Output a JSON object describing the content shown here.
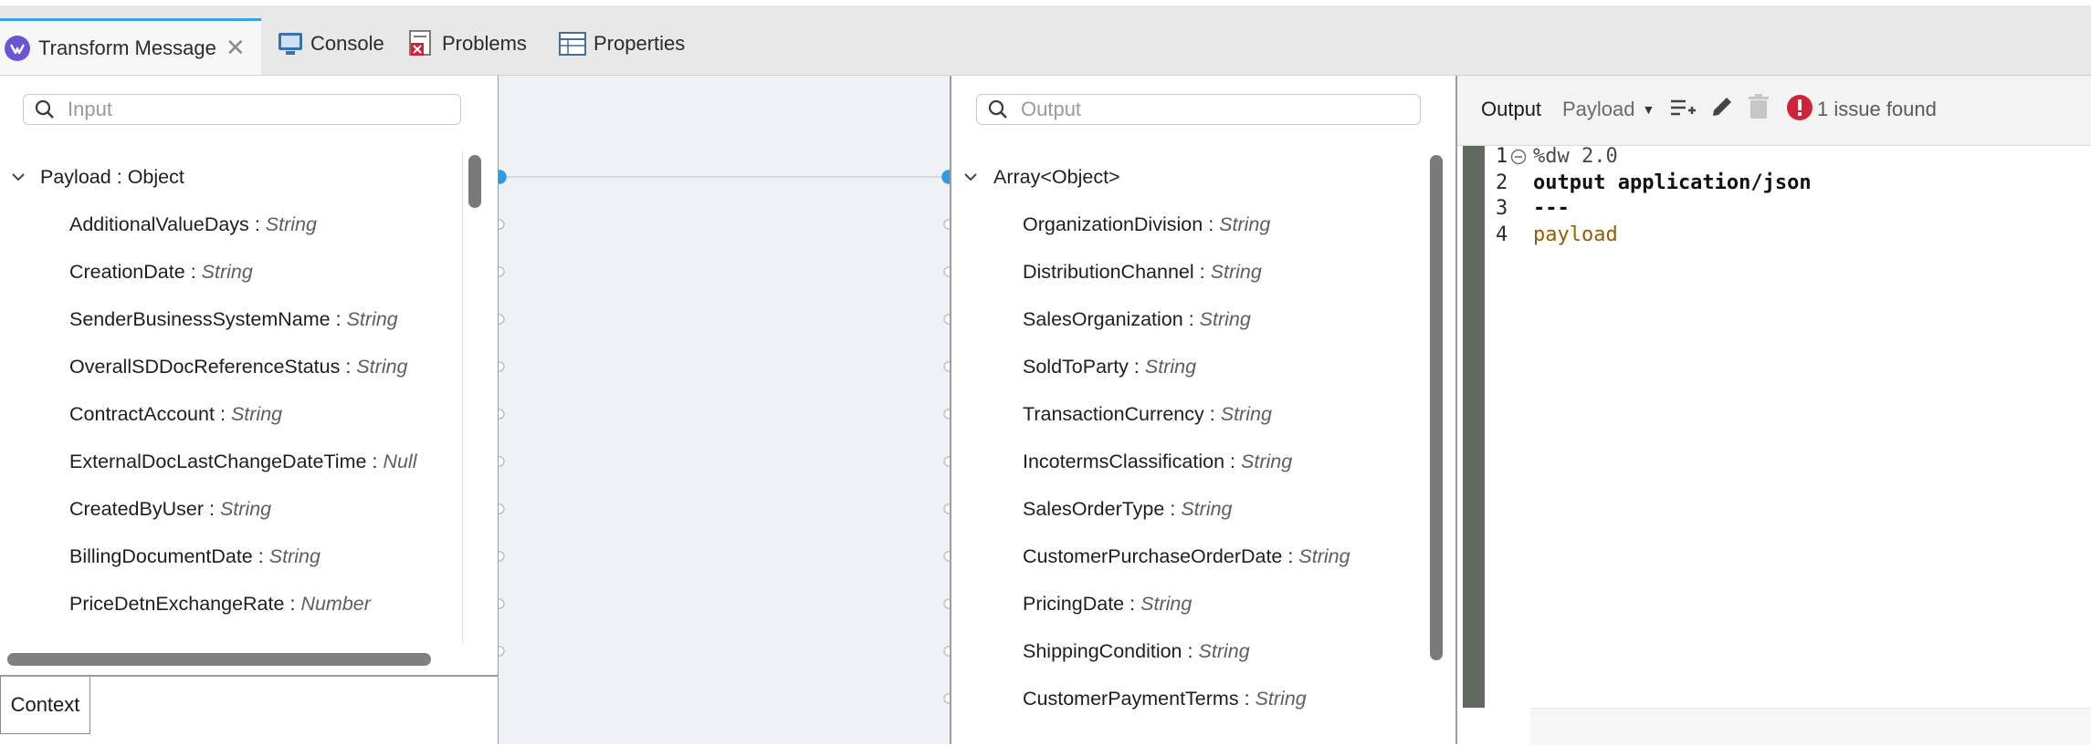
{
  "tabs": [
    {
      "label": "Transform Message",
      "active": true
    },
    {
      "label": "Console"
    },
    {
      "label": "Problems"
    },
    {
      "label": "Properties"
    }
  ],
  "input": {
    "search_placeholder": "Input",
    "root_name": "Payload",
    "root_type": "Object",
    "fields": [
      {
        "name": "AdditionalValueDays",
        "type": "String"
      },
      {
        "name": "CreationDate",
        "type": "String"
      },
      {
        "name": "SenderBusinessSystemName",
        "type": "String"
      },
      {
        "name": "OverallSDDocReferenceStatus",
        "type": "String"
      },
      {
        "name": "ContractAccount",
        "type": "String"
      },
      {
        "name": "ExternalDocLastChangeDateTime",
        "type": "Null"
      },
      {
        "name": "CreatedByUser",
        "type": "String"
      },
      {
        "name": "BillingDocumentDate",
        "type": "String"
      },
      {
        "name": "PriceDetnExchangeRate",
        "type": "Number"
      }
    ],
    "context_tab": "Context"
  },
  "output": {
    "search_placeholder": "Output",
    "root_label": "Array<Object>",
    "fields": [
      {
        "name": "OrganizationDivision",
        "type": "String"
      },
      {
        "name": "DistributionChannel",
        "type": "String"
      },
      {
        "name": "SalesOrganization",
        "type": "String"
      },
      {
        "name": "SoldToParty",
        "type": "String"
      },
      {
        "name": "TransactionCurrency",
        "type": "String"
      },
      {
        "name": "IncotermsClassification",
        "type": "String"
      },
      {
        "name": "SalesOrderType",
        "type": "String"
      },
      {
        "name": "CustomerPurchaseOrderDate",
        "type": "String"
      },
      {
        "name": "PricingDate",
        "type": "String"
      },
      {
        "name": "ShippingCondition",
        "type": "String"
      },
      {
        "name": "CustomerPaymentTerms",
        "type": "String"
      }
    ]
  },
  "script": {
    "toolbar_output": "Output",
    "toolbar_payload": "Payload",
    "issues": "1 issue found",
    "lines": [
      {
        "num": "1",
        "text": "%dw 2.0"
      },
      {
        "num": "2",
        "text": "output application/json"
      },
      {
        "num": "3",
        "text": "---"
      },
      {
        "num": "4",
        "text": "payload"
      }
    ]
  },
  "colors": {
    "accent": "#3aa0e6",
    "connector": "#2f9be0",
    "error": "#d0233a",
    "payload_keyword": "#9a5a00",
    "gutter": "#606860"
  },
  "icons": [
    "dataweave-icon",
    "console-icon",
    "problems-icon",
    "properties-icon",
    "search-icon",
    "chevron-down-icon",
    "add-row-icon",
    "edit-icon",
    "trash-icon",
    "error-icon"
  ]
}
